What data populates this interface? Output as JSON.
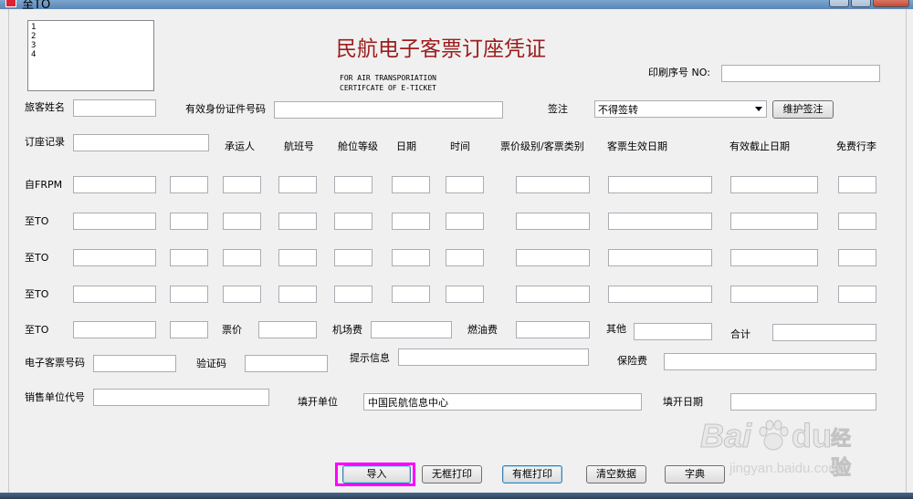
{
  "window": {
    "title": "至TO"
  },
  "listbox": {
    "items": [
      "1",
      "2",
      "3",
      "4"
    ]
  },
  "header": {
    "title": "民航电子客票订座凭证",
    "subtitle_line1": "FOR AIR TRANSPORIATION",
    "subtitle_line2": "CERTIFCATE OF E-TICKET",
    "print_no_label": "印刷序号 NO:"
  },
  "passenger": {
    "name_label": "旅客姓名",
    "id_label": "有效身份证件号码",
    "endorse_label": "签注",
    "endorse_value": "不得签转",
    "maintain_button": "维护签注"
  },
  "booking": {
    "record_label": "订座记录",
    "columns": [
      "承运人",
      "航班号",
      "舱位等级",
      "日期",
      "时间",
      "票价级别/客票类别",
      "客票生效日期",
      "有效截止日期",
      "免费行李"
    ]
  },
  "segments": {
    "labels": [
      "自FRPM",
      "至TO",
      "至TO",
      "至TO",
      "至TO"
    ]
  },
  "fees": {
    "fare_label": "票价",
    "airport_label": "机场费",
    "fuel_label": "燃油费",
    "other_label": "其他",
    "total_label": "合计",
    "insurance_label": "保险费"
  },
  "ticket": {
    "eticket_no_label": "电子客票号码",
    "verify_label": "验证码",
    "hint_label": "提示信息"
  },
  "issuer": {
    "agent_code_label": "销售单位代号",
    "unit_label": "填开单位",
    "unit_value": "中国民航信息中心",
    "date_label": "填开日期"
  },
  "buttons": {
    "import": "导入",
    "print_noframe": "无框打印",
    "print_frame": "有框打印",
    "clear": "清空数据",
    "dictionary": "字典"
  },
  "watermark": {
    "brand_left": "Bai",
    "brand_right": "du",
    "brand_cn": "经验",
    "url": "jingyan.baidu.com"
  },
  "colors": {
    "title": "#9c1c1c",
    "highlight": "#ff00ff"
  }
}
